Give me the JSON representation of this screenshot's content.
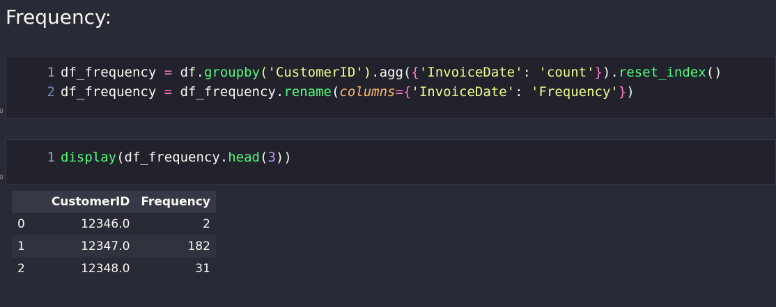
{
  "heading": "Frequency:",
  "cell1": {
    "lines": [
      [
        "1",
        "df_frequency",
        " = ",
        "df.",
        "groupby",
        "('CustomerID')",
        ".agg(",
        "{",
        "'InvoiceDate'",
        ": ",
        "'count'",
        "}",
        ").",
        "reset_index",
        "()"
      ],
      [
        "2",
        "df_frequency",
        " = ",
        "df_frequency.",
        "rename",
        "(",
        "columns",
        "=",
        "{",
        "'InvoiceDate'",
        ": ",
        "'Frequency'",
        "}",
        ")"
      ]
    ]
  },
  "cell2": {
    "line": [
      "1",
      "display",
      "(df_frequency.",
      "head",
      "(",
      "3",
      "))"
    ]
  },
  "table": {
    "columns": [
      "",
      "CustomerID",
      "Frequency"
    ],
    "rows": [
      [
        "0",
        "12346.0",
        "2"
      ],
      [
        "1",
        "12347.0",
        "182"
      ],
      [
        "2",
        "12348.0",
        "31"
      ]
    ]
  }
}
